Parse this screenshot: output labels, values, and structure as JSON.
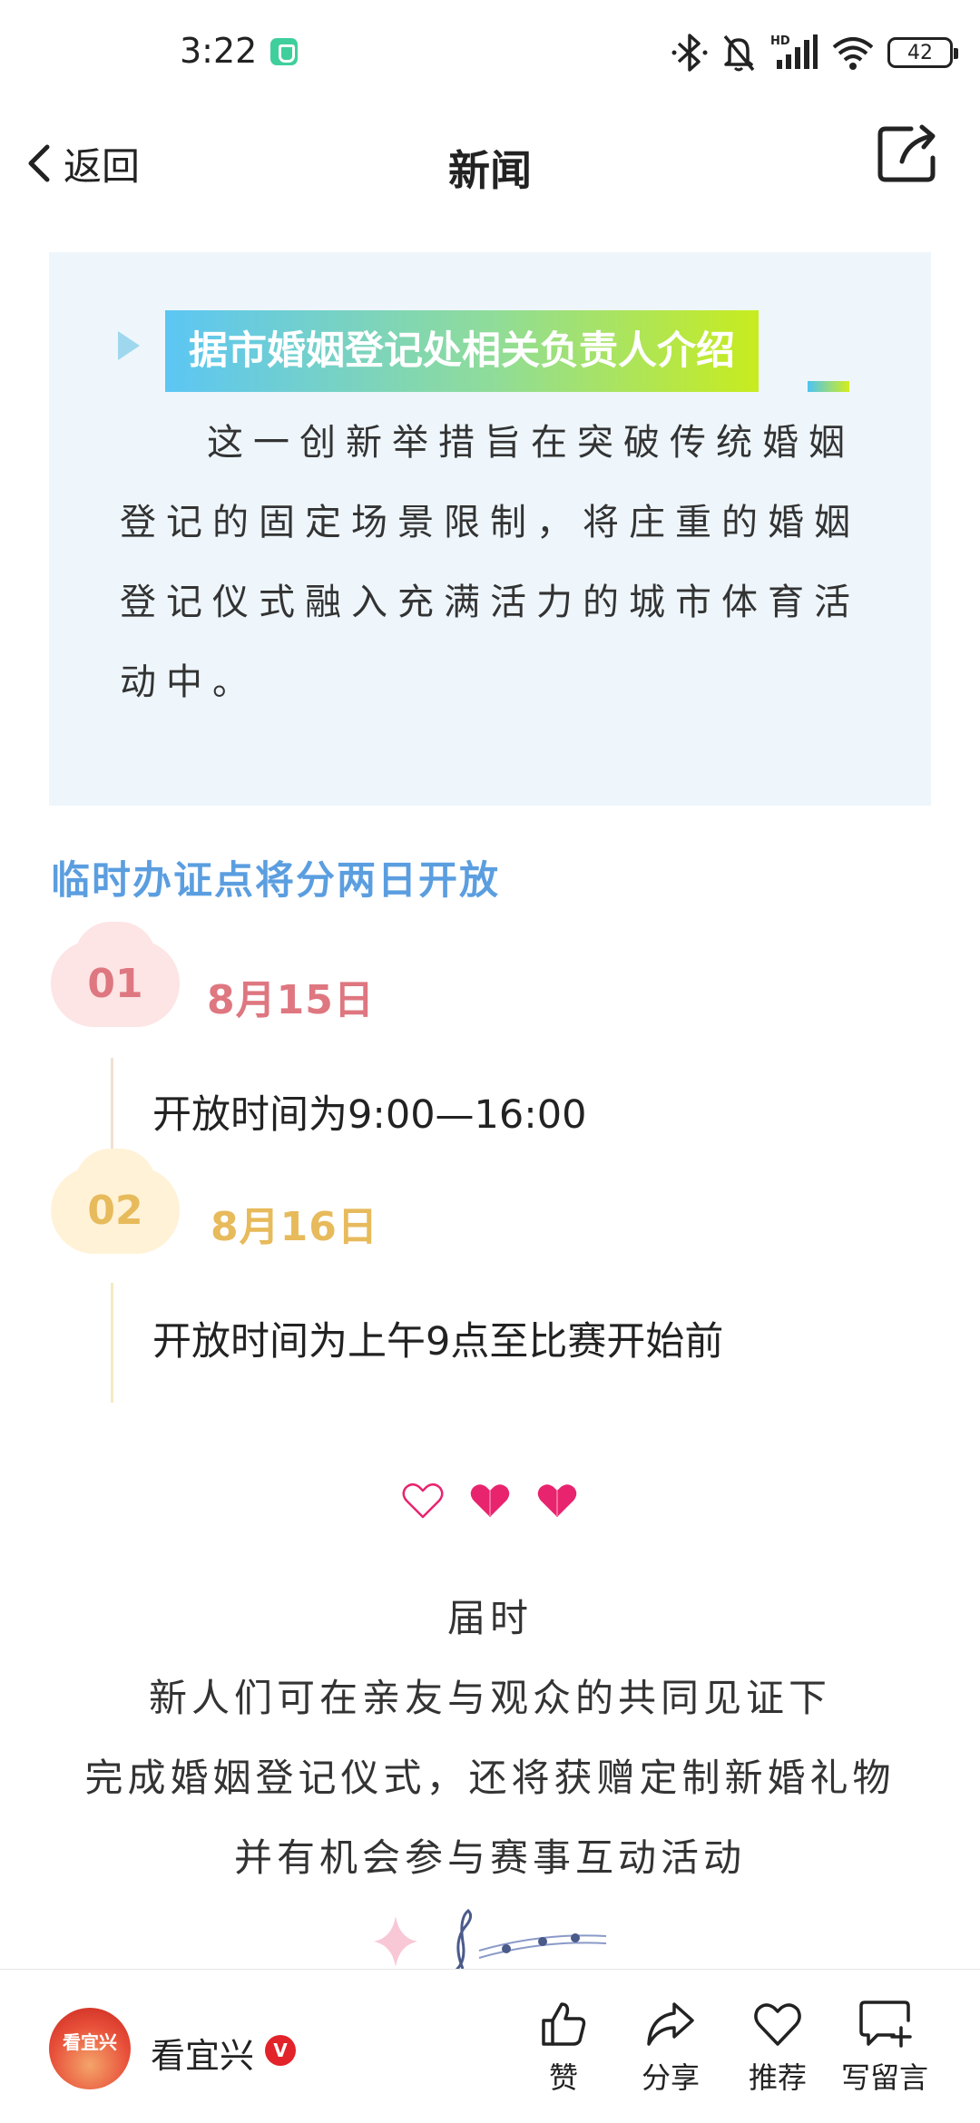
{
  "status_bar": {
    "time": "3:22",
    "battery": "42",
    "icons": [
      "bluetooth-icon",
      "mute-bell-icon",
      "hd-signal-icon",
      "wifi-icon",
      "battery-icon"
    ]
  },
  "nav": {
    "back_label": "返回",
    "title": "新闻",
    "share_icon": "share-square-icon"
  },
  "article": {
    "quote_box": {
      "heading": "据市婚姻登记处相关负责人介绍",
      "text": "这一创新举措旨在突破传统婚姻登记的固定场景限制，将庄重的婚姻登记仪式融入充满活力的城市体育活动中。",
      "heading_gradient": [
        "#5cc6f4",
        "#c8ec1e"
      ],
      "background": "#eef6fb"
    },
    "section_heading": "临时办证点将分两日开放",
    "items": [
      {
        "number": "01",
        "date": "8月15日",
        "text": "开放时间为9:00—16:00",
        "color": "#de7780"
      },
      {
        "number": "02",
        "date": "8月16日",
        "text": "开放时间为上午9点至比赛开始前",
        "color": "#e7ba5b"
      }
    ],
    "hearts": [
      "heart-outline-icon",
      "heart-filled-icon",
      "heart-filled-icon"
    ],
    "closing_lines": [
      "届时",
      "新人们可在亲友与观众的共同见证下",
      "完成婚姻登记仪式，还将获赠定制新婚礼物",
      "并有机会参与赛事互动活动"
    ]
  },
  "bottom_bar": {
    "avatar_text": "看宜兴",
    "account_name": "看宜兴",
    "verified": "V",
    "actions": [
      {
        "icon": "thumbs-up-icon",
        "label": "赞"
      },
      {
        "icon": "share-arrow-icon",
        "label": "分享"
      },
      {
        "icon": "heart-icon",
        "label": "推荐"
      },
      {
        "icon": "comment-icon",
        "label": "写留言"
      }
    ]
  }
}
